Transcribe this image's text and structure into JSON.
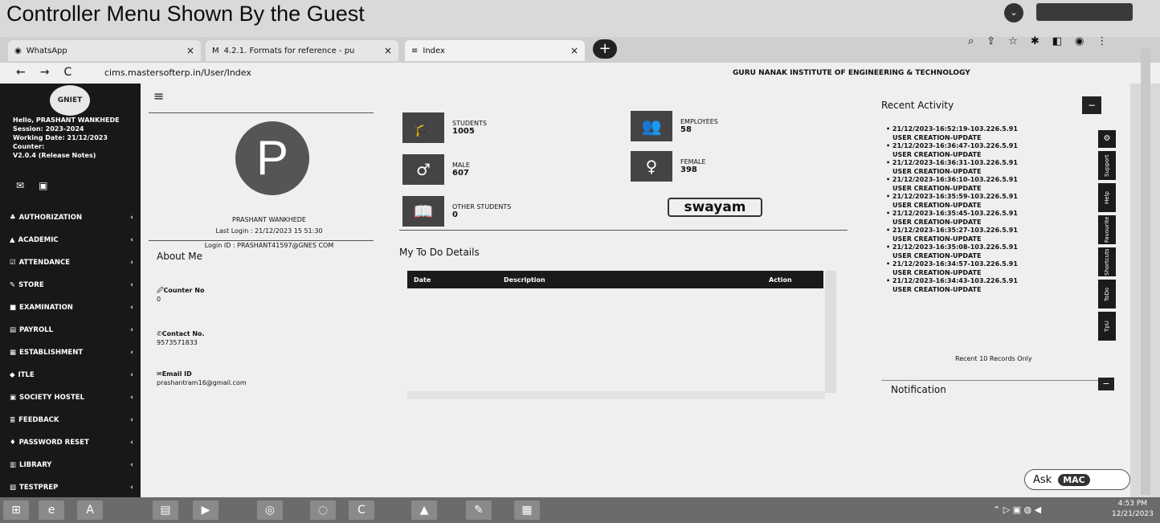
{
  "caption": "Controller Menu Shown By  the Guest",
  "tabs": [
    {
      "label": "WhatsApp",
      "close": "×"
    },
    {
      "label": "4.2.1. Formats for reference - pu",
      "close": "×"
    },
    {
      "label": "Index",
      "close": "×"
    }
  ],
  "new_tab": "+",
  "address": {
    "url": "cims.mastersofterp.in/User/Index",
    "back": "←",
    "forward": "→",
    "reload": "C"
  },
  "institute": "GURU NANAK INSTITUTE OF ENGINEERING & TECHNOLOGY",
  "sidebar": {
    "logo": "GNIET",
    "info": [
      "Hello, PRASHANT WANKHEDE",
      "Session: 2023-2024",
      "Working Date: 21/12/2023",
      "Counter:",
      "V2.0.4 (Release Notes)"
    ],
    "menu": [
      {
        "label": "AUTHORIZATION",
        "icon": "key-icon"
      },
      {
        "label": "ACADEMIC",
        "icon": "graduation-cap-icon"
      },
      {
        "label": "ATTENDANCE",
        "icon": "check-icon"
      },
      {
        "label": "STORE",
        "icon": "store-icon"
      },
      {
        "label": "EXAMINATION",
        "icon": "exam-icon"
      },
      {
        "label": "PAYROLL",
        "icon": "payroll-icon"
      },
      {
        "label": "ESTABLISHMENT",
        "icon": "building-icon"
      },
      {
        "label": "ITLE",
        "icon": "itle-icon"
      },
      {
        "label": "SOCIETY HOSTEL",
        "icon": "hostel-icon"
      },
      {
        "label": "FEEDBACK",
        "icon": "feedback-icon"
      },
      {
        "label": "PASSWORD RESET",
        "icon": "lock-icon"
      },
      {
        "label": "LIBRARY",
        "icon": "library-icon"
      },
      {
        "label": "TESTPREP",
        "icon": "testprep-icon"
      }
    ]
  },
  "profile": {
    "initial": "P",
    "name": "PRASHANT WANKHEDE",
    "last_login": "Last Login : 21/12/2023 15 51:30",
    "login_id": "Login ID : PRASHANT41597@GNES COM"
  },
  "about": {
    "title": "About Me",
    "counter_label": "Counter No",
    "counter_value": "0",
    "contact_label": "Contact No.",
    "contact_value": "9573571833",
    "email_label": "Email ID",
    "email_value": "prashantram16@gmail.com"
  },
  "stats": {
    "students_label": "STUDENTS",
    "students_value": "1005",
    "employees_label": "EMPLOYEES",
    "employees_value": "58",
    "male_label": "MALE",
    "male_value": "607",
    "female_label": "FEMALE",
    "female_value": "398",
    "other_label": "OTHER STUDENTS",
    "other_value": "0"
  },
  "swayam": "swayam",
  "todo": {
    "title": "My To Do Details",
    "col_date": "Date",
    "col_desc": "Description",
    "col_action": "Action"
  },
  "recent": {
    "title": "Recent Activity",
    "items": [
      {
        "ts": "21/12/2023-16:52:19-103.226.5.91",
        "action": "USER CREATION-UPDATE"
      },
      {
        "ts": "21/12/2023-16:36:47-103.226.5.91",
        "action": "USER CREATION-UPDATE"
      },
      {
        "ts": "21/12/2023-16:36:31-103.226.5.91",
        "action": "USER CREATION-UPDATE"
      },
      {
        "ts": "21/12/2023-16:36:10-103.226.5.91",
        "action": "USER CREATION-UPDATE"
      },
      {
        "ts": "21/12/2023-16:35:59-103.226.5.91",
        "action": "USER CREATION-UPDATE"
      },
      {
        "ts": "21/12/2023-16:35:45-103.226.5.91",
        "action": "USER CREATION-UPDATE"
      },
      {
        "ts": "21/12/2023-16:35:27-103.226.5.91",
        "action": "USER CREATION-UPDATE"
      },
      {
        "ts": "21/12/2023-16:35:08-103.226.5.91",
        "action": "USER CREATION-UPDATE"
      },
      {
        "ts": "21/12/2023-16:34:57-103.226.5.91",
        "action": "USER CREATION-UPDATE"
      },
      {
        "ts": "21/12/2023-16:34:43-103.226.5.91",
        "action": "USER CREATION-UPDATE"
      }
    ],
    "footer": "Recent 10 Records Only"
  },
  "notification": {
    "title": "Notification"
  },
  "side_tabs": [
    "Support",
    "Help",
    "Favourite",
    "Shortcuts",
    "ToDo",
    "TpU"
  ],
  "ask": {
    "label": "Ask",
    "brand": "MAC"
  },
  "clock": {
    "time": "4:53 PM",
    "date": "12/21/2023"
  }
}
